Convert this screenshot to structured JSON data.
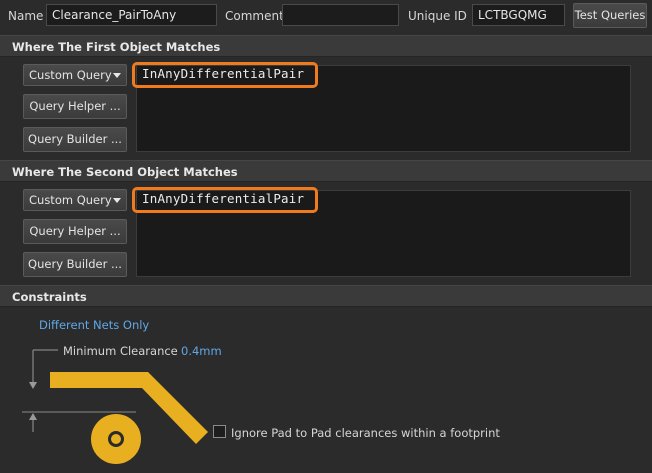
{
  "header": {
    "name_label": "Name",
    "name_value": "Clearance_PairToAny",
    "comment_label": "Comment",
    "comment_value": "",
    "unique_id_label": "Unique ID",
    "unique_id_value": "LCTBGQMG",
    "test_queries_label": "Test Queries"
  },
  "first_object": {
    "section_title": "Where The First Object Matches",
    "query_type": "Custom Query",
    "query_helper_label": "Query Helper ...",
    "query_builder_label": "Query Builder ...",
    "query_text": "InAnyDifferentialPair"
  },
  "second_object": {
    "section_title": "Where The Second Object Matches",
    "query_type": "Custom Query",
    "query_helper_label": "Query Helper ...",
    "query_builder_label": "Query Builder ...",
    "query_text": "InAnyDifferentialPair"
  },
  "constraints": {
    "section_title": "Constraints",
    "different_nets_label": "Different Nets Only",
    "min_clearance_label": "Minimum Clearance",
    "min_clearance_value": "0.4mm",
    "ignore_pad_label": "Ignore Pad to Pad clearances within a footprint",
    "ignore_pad_checked": false
  },
  "colors": {
    "accent_orange": "#f07a1e",
    "link_blue": "#5fa8e8",
    "copper_yellow": "#e8b020"
  }
}
